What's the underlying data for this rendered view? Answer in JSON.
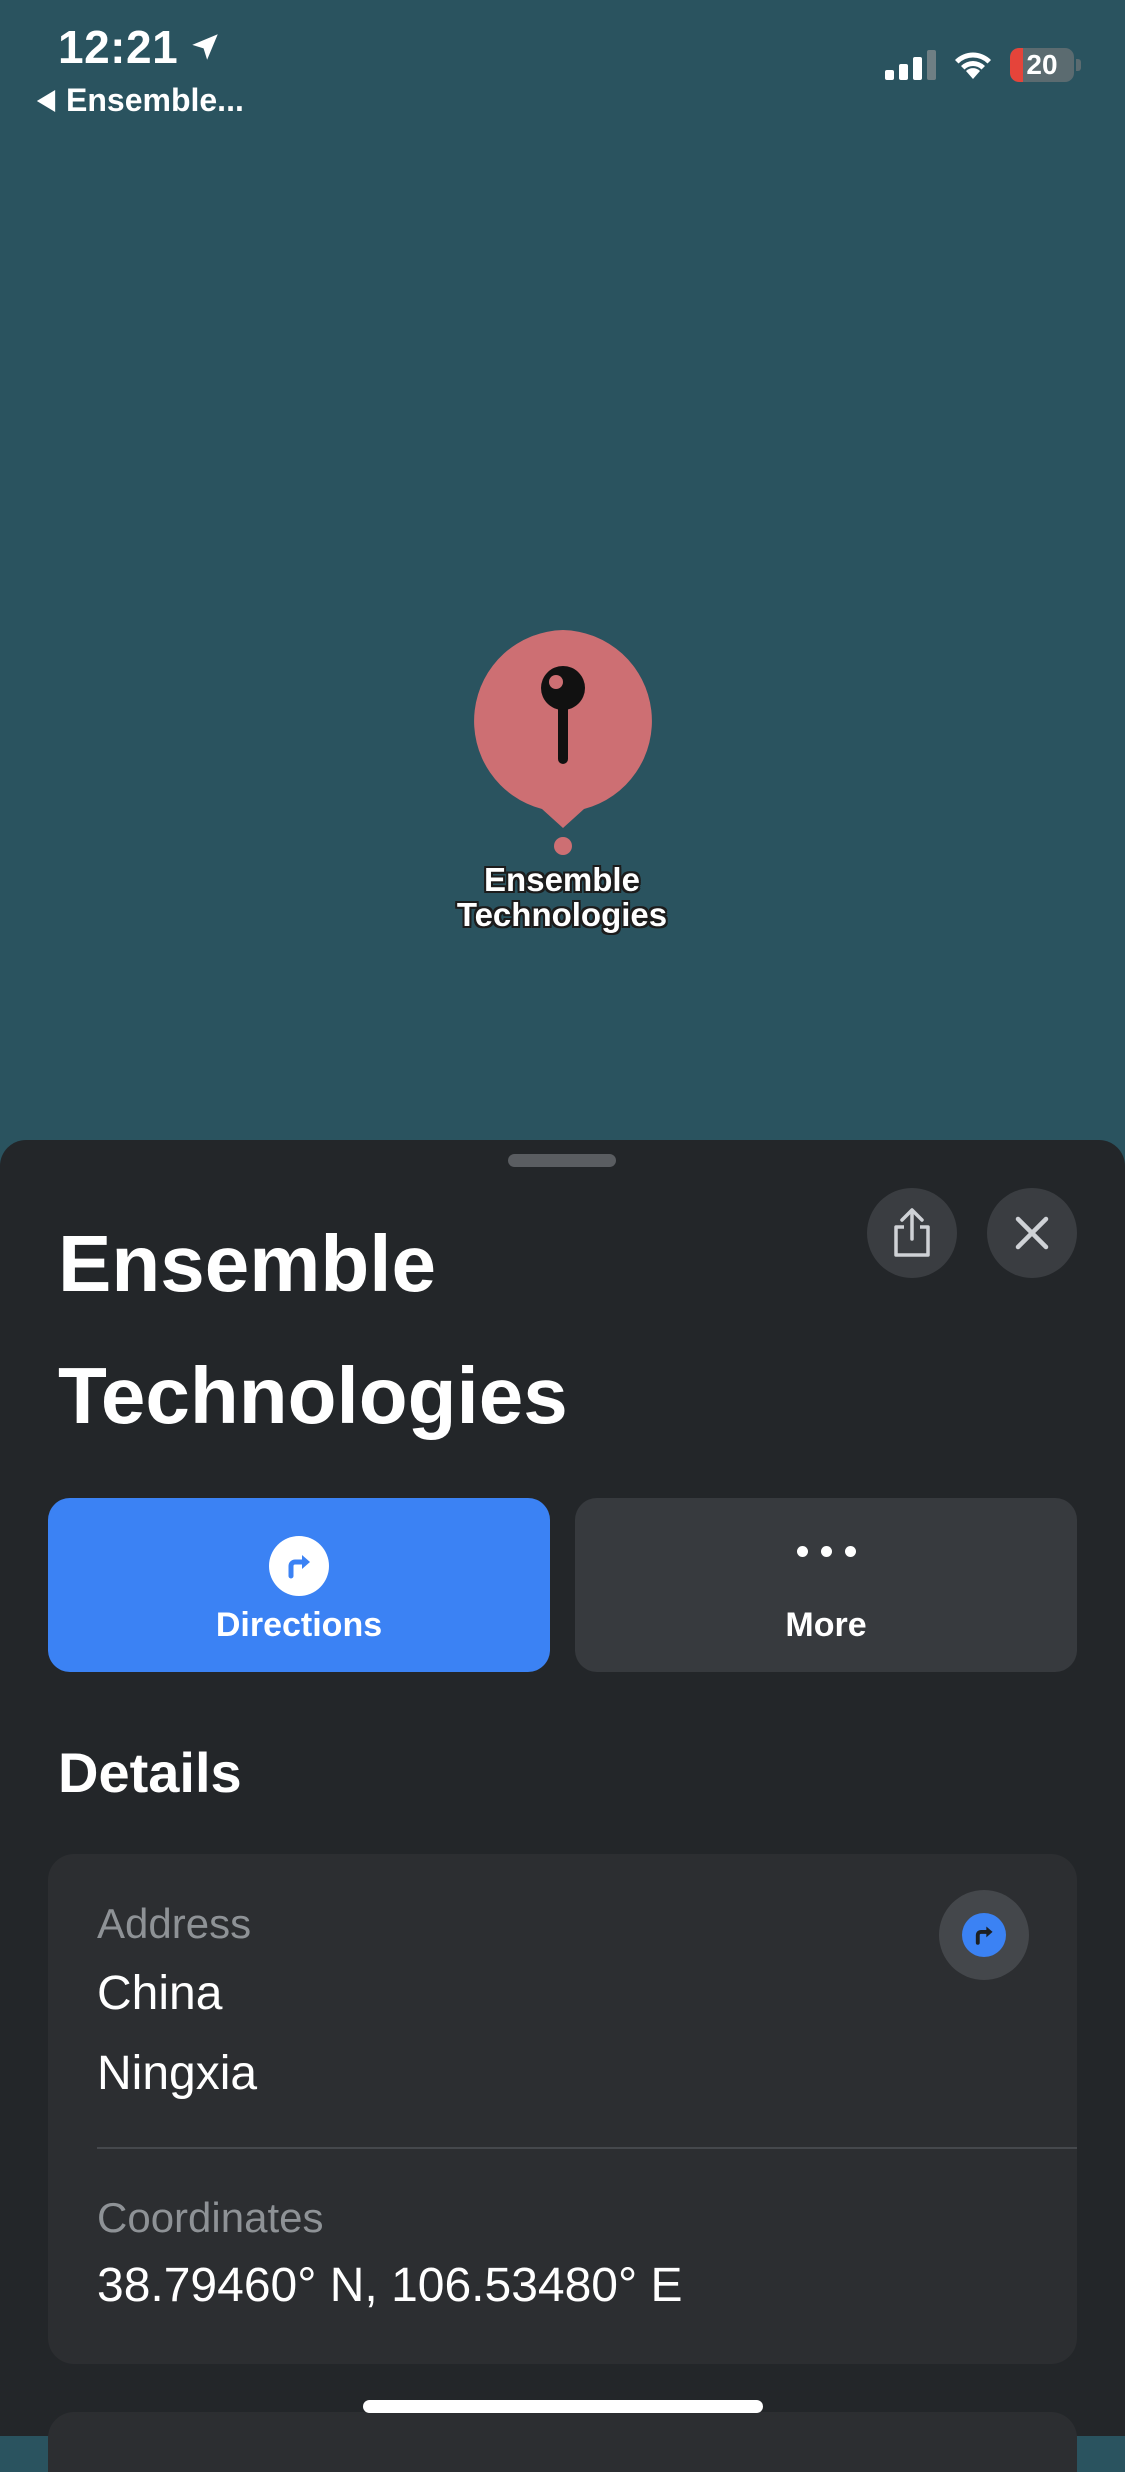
{
  "status_bar": {
    "time": "12:21",
    "back_label": "Ensemble...",
    "battery_level": "20",
    "battery_fraction": 0.2
  },
  "map": {
    "pin_label_line1": "Ensemble",
    "pin_label_line2": "Technologies",
    "pin_color": "#cd6f73",
    "background_color": "#2a535f"
  },
  "place": {
    "title_line1": "Ensemble",
    "title_line2": "Technologies"
  },
  "actions": {
    "directions_label": "Directions",
    "more_label": "More",
    "accent_color": "#3b82f4"
  },
  "details": {
    "heading": "Details",
    "address_label": "Address",
    "address_line1": "China",
    "address_line2": "Ningxia",
    "coordinates_label": "Coordinates",
    "coordinates_value": "38.79460° N, 106.53480° E"
  },
  "icons": [
    "location-arrow-icon",
    "back-arrow-icon",
    "cellular-signal-icon",
    "wifi-icon",
    "battery-icon",
    "map-pin-icon",
    "share-icon",
    "close-icon",
    "directions-icon",
    "more-icon"
  ]
}
